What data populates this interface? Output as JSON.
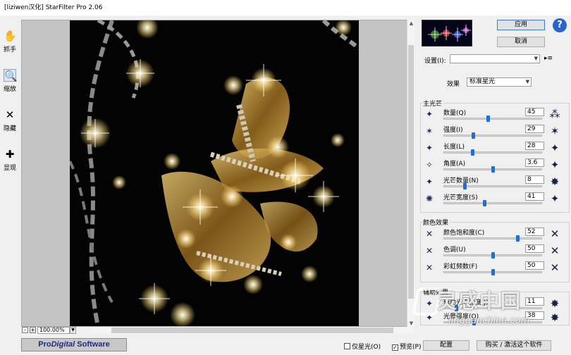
{
  "window": {
    "title": "[liziwen汉化] StarFilter Pro 2.06"
  },
  "tools": [
    {
      "label": "抓手",
      "icon": "hand-icon"
    },
    {
      "label": "缩放",
      "icon": "zoom-icon"
    },
    {
      "label": "隐藏",
      "icon": "hide-icon"
    },
    {
      "label": "显现",
      "icon": "show-icon"
    }
  ],
  "zoom": {
    "minus": "-",
    "plus": "+",
    "value": "100.00%"
  },
  "brand": {
    "prefix": "Pro",
    "italic": "Digital",
    "suffix": " Software"
  },
  "bottom": {
    "only_star_label": "仅星光(O)",
    "only_star_checked": false,
    "preview_label": "预览(P)",
    "preview_checked": true,
    "config_button": "配置",
    "buy_button": "购买 / 激活这个软件"
  },
  "buttons": {
    "apply": "应用",
    "cancel": "取消",
    "help": "?"
  },
  "settings": {
    "label": "设置(I):",
    "value": "",
    "menu_icon": "▸≡"
  },
  "effect": {
    "label": "效果",
    "value": "标准星光"
  },
  "main_rays": {
    "title": "主光芒",
    "params": [
      {
        "label": "数量(Q)",
        "value": "45",
        "fraction": 0.45
      },
      {
        "label": "强度(I)",
        "value": "29",
        "fraction": 0.29
      },
      {
        "label": "长度(L)",
        "value": "28",
        "fraction": 0.28
      },
      {
        "label": "角度(A)",
        "value": "3.6",
        "fraction": 0.5
      },
      {
        "label": "光芒数量(N)",
        "value": "8",
        "fraction": 0.2
      },
      {
        "label": "光芒宽度(S)",
        "value": "41",
        "fraction": 0.41
      }
    ]
  },
  "color_effects": {
    "title": "颜色效果",
    "params": [
      {
        "label": "颜色饱和度(C)",
        "value": "52",
        "fraction": 0.76
      },
      {
        "label": "色调(U)",
        "value": "50",
        "fraction": 0.5
      },
      {
        "label": "彩虹频数(F)",
        "value": "50",
        "fraction": 0.5
      }
    ]
  },
  "aux_effects": {
    "title": "辅助效果",
    "params": [
      {
        "label": "辅助光芒强度(J)",
        "value": "11",
        "fraction": 0.11
      },
      {
        "label": "光晕强度(O)",
        "value": "38",
        "fraction": 0.3
      }
    ]
  },
  "watermark": {
    "text": "灵感中国",
    "url": "lingganchina.com"
  },
  "colors": {
    "accent": "#1e6fd8",
    "brand": "#1f2a80",
    "help": "#2a63c9"
  }
}
